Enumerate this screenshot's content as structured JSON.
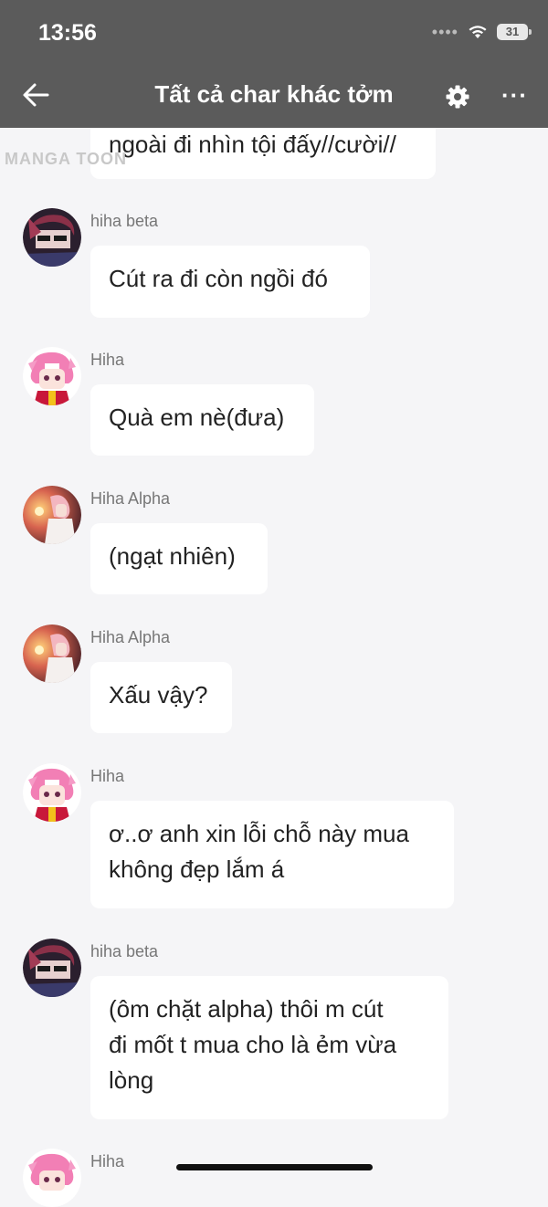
{
  "status": {
    "time": "13:56",
    "battery": "31"
  },
  "header": {
    "title": "Tất cả char khác tởm"
  },
  "watermark": "MANGA TOON",
  "messages": [
    {
      "text": "ngoài đi nhìn tội đấy//cười//"
    },
    {
      "name": "hiha beta",
      "text": "Cút ra đi còn ngồi đó"
    },
    {
      "name": "Hiha",
      "text": "Quà em nè(đưa)"
    },
    {
      "name": "Hiha Alpha",
      "text": "(ngạt nhiên)"
    },
    {
      "name": "Hiha Alpha",
      "text": "Xấu vậy?"
    },
    {
      "name": "Hiha",
      "text": "ơ..ơ anh xin lỗi chỗ này mua\nkhông đẹp lắm á"
    },
    {
      "name": "hiha beta",
      "text": "(ôm chặt alpha) thôi m cút\nđi mốt t mua cho là ẻm vừa\nlòng"
    },
    {
      "name": "Hiha"
    }
  ]
}
